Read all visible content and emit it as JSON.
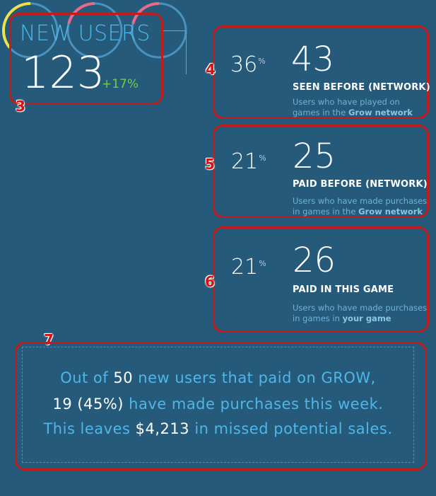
{
  "new_users": {
    "title": "NEW USERS",
    "count": "123",
    "delta": "+17%"
  },
  "cards": [
    {
      "badge": "4",
      "percent_value": 36,
      "percent_text": "36",
      "percent_symbol": "%",
      "ring_color": "#f0e24a",
      "value": "43",
      "title": "SEEN BEFORE (NETWORK)",
      "desc_prefix_line1": "Users who have played on",
      "desc_prefix_line2": "games in the ",
      "desc_bold": "Grow network"
    },
    {
      "badge": "5",
      "percent_value": 21,
      "percent_text": "21",
      "percent_symbol": "%",
      "ring_color": "#e86a8a",
      "value": "25",
      "title": "PAID BEFORE (NETWORK)",
      "desc_prefix_line1": "Users who have made purchases",
      "desc_prefix_line2": "in games in the ",
      "desc_bold": "Grow network"
    },
    {
      "badge": "6",
      "percent_value": 21,
      "percent_text": "21",
      "percent_symbol": "%",
      "ring_color": "#e86a8a",
      "value": "26",
      "title": "PAID IN THIS GAME",
      "desc_prefix_line1": "Users who have made purchases",
      "desc_prefix_line2": "in games in ",
      "desc_bold": "your game"
    }
  ],
  "badges": {
    "new_users": "3",
    "summary": "7"
  },
  "summary": {
    "l1_a": "Out of ",
    "l1_b": "50",
    "l1_c": " new users that paid on GROW,",
    "l2_a": "19 (45%)",
    "l2_b": " have made purchases this week.",
    "l3_a": "This leaves ",
    "l3_b": "$4,213",
    "l3_c": " in missed potential sales."
  },
  "colors": {
    "background": "#255a7b",
    "accent": "#4fb6e6",
    "positive": "#6fcf4a",
    "ring_track": "#4a93c0",
    "callout": "#c11b1b"
  }
}
